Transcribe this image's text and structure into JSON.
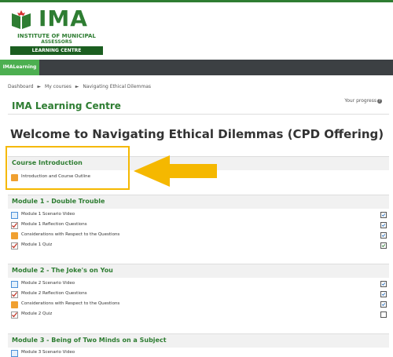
{
  "logo": {
    "name": "IMA",
    "line1": "INSTITUTE OF MUNICIPAL",
    "line2": "ASSESSORS",
    "bar": "LEARNING CENTRE"
  },
  "nav": {
    "active_tab": "IMALearning"
  },
  "breadcrumb": [
    "Dashboard",
    "►",
    "My courses",
    "►",
    "Navigating Ethical Dilemmas"
  ],
  "site_title": "IMA Learning Centre",
  "progress_label": "Your progress",
  "page_heading": "Welcome to Navigating Ethical Dilemmas (CPD Offering)",
  "sections": [
    {
      "title": "Course Introduction",
      "activities": [
        {
          "label": "Introduction and Course Outline",
          "icon": "folder-icon",
          "completion": "none"
        }
      ]
    },
    {
      "title": "Module 1 - Double Trouble",
      "activities": [
        {
          "label": "Module 1 Scenario Video",
          "icon": "page-icon",
          "completion": "done"
        },
        {
          "label": "Module 1 Reflection Questions",
          "icon": "questionnaire-icon",
          "completion": "done"
        },
        {
          "label": "Considerations with Respect to the Questions",
          "icon": "folder-icon",
          "completion": "done"
        },
        {
          "label": "Module 1 Quiz",
          "icon": "quiz-icon",
          "completion": "done-pass"
        }
      ]
    },
    {
      "title": "Module 2 - The Joke's on You",
      "activities": [
        {
          "label": "Module 2 Scenario Video",
          "icon": "page-icon",
          "completion": "done"
        },
        {
          "label": "Module 2 Reflection Questions",
          "icon": "questionnaire-icon",
          "completion": "done"
        },
        {
          "label": "Considerations with Respect to the Questions",
          "icon": "folder-icon",
          "completion": "done"
        },
        {
          "label": "Module 2 Quiz",
          "icon": "quiz-icon",
          "completion": "empty"
        }
      ]
    },
    {
      "title": "Module 3 - Being of Two Minds on a Subject",
      "activities": [
        {
          "label": "Module 3 Scenario Video",
          "icon": "page-icon",
          "completion": "none"
        }
      ]
    }
  ],
  "colors": {
    "brand_green": "#2e7d32",
    "nav_dark": "#3c4043",
    "tab_green": "#4caf50",
    "highlight": "#f5b800"
  }
}
